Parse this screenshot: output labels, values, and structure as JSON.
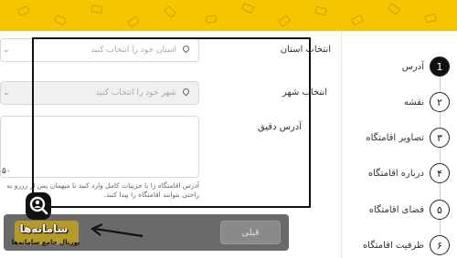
{
  "colors": {
    "accent": "#f7c500",
    "highlight_border": "#111111",
    "step_active": "#111111"
  },
  "steps": [
    {
      "number": "1",
      "label": "آدرس",
      "active": true
    },
    {
      "number": "۲",
      "label": "نقشه",
      "active": false
    },
    {
      "number": "۳",
      "label": "تصاویر اقامتگاه",
      "active": false
    },
    {
      "number": "۴",
      "label": "درباره اقامتگاه",
      "active": false
    },
    {
      "number": "۵",
      "label": "فضای اقامتگاه",
      "active": false
    },
    {
      "number": "۶",
      "label": "ظرفیت اقامتگاه",
      "active": false
    }
  ],
  "form": {
    "province_label": "انتخاب استان",
    "province_placeholder": "استان خود را انتخاب کنید",
    "city_label": "انتخاب شهر",
    "city_placeholder": "شهر خود را انتخاب کنید",
    "address_label": "آدرس دقیق",
    "address_value": "",
    "char_counter": "۵۰",
    "hint": "آدرس اقامتگاه را با جزییات کامل وارد کنید تا میهمان پس از رزرو به راحتی بتوانند اقامتگاه را پیدا کنند."
  },
  "nav": {
    "prev_label": "قبلی",
    "next_label": ""
  },
  "watermark": {
    "title": "سامانه‌ها",
    "subtitle": "پورتال جامع سامانه‌ها",
    "icon": "search-person-icon"
  }
}
